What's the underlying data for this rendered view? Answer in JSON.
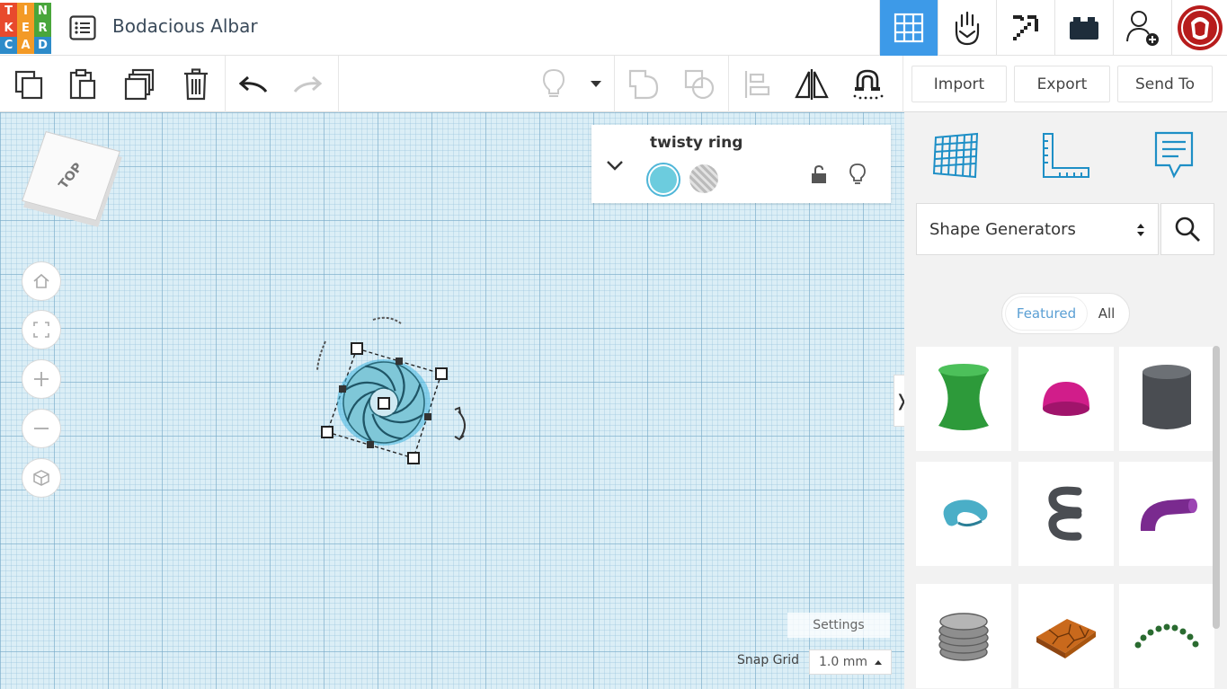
{
  "header": {
    "logo_letters": [
      "T",
      "I",
      "N",
      "K",
      "E",
      "R",
      "C",
      "A",
      "D"
    ],
    "logo_colors": [
      "#e84a2d",
      "#f39a26",
      "#49a63b",
      "#e84a2d",
      "#f39a26",
      "#49a63b",
      "#2d8bc9",
      "#f39a26",
      "#2d8bc9"
    ],
    "design_title": "Bodacious Albar",
    "icons": [
      "grid-view-icon",
      "circuits-icon",
      "minecraft-pickaxe-icon",
      "lego-brick-icon",
      "add-user-icon",
      "avatar-icon"
    ],
    "accent_color": "#3d9ae8"
  },
  "toolbar": {
    "import_label": "Import",
    "export_label": "Export",
    "sendto_label": "Send To"
  },
  "workplane": {
    "viewcube_label": "TOP",
    "inspector_title": "twisty ring",
    "solid_color": "#6cccde",
    "settings_label": "Settings",
    "snap_grid_label": "Snap Grid",
    "snap_grid_value": "1.0 mm",
    "collapse_glyph": "❭"
  },
  "panel": {
    "category": "Shape Generators",
    "tabs": [
      "Featured",
      "All"
    ],
    "shapes": [
      {
        "name": "hyperboloid",
        "color": "#2d9a3a"
      },
      {
        "name": "half-sphere",
        "color": "#d11d8a"
      },
      {
        "name": "tube-cylinder",
        "color": "#4a4d52"
      },
      {
        "name": "torus-partial",
        "color": "#4aaec7"
      },
      {
        "name": "spring",
        "color": "#4a4d52"
      },
      {
        "name": "bent-pipe",
        "color": "#7a2a8f"
      },
      {
        "name": "screw-thread",
        "color": "#8e8e8e"
      },
      {
        "name": "voronoi-tile",
        "color": "#c9691c"
      },
      {
        "name": "bead-chain-arc",
        "color": "#2a6b30"
      }
    ]
  }
}
